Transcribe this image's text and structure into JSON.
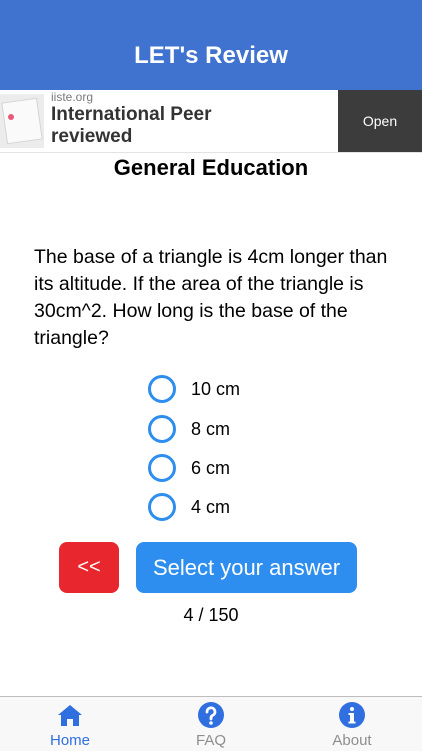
{
  "header": {
    "title": "LET's Review"
  },
  "ad": {
    "domain": "iiste.org",
    "headline": "International Peer reviewed",
    "cta": "Open"
  },
  "quiz": {
    "category": "General Education",
    "question": "The base of a triangle is 4cm longer than its altitude. If the area of the triangle is 30cm^2. How long is the base of the triangle?",
    "options": [
      "10 cm",
      "8 cm",
      "6 cm",
      "4 cm"
    ],
    "prev_label": "<<",
    "submit_label": "Select your answer",
    "progress": "4 / 150"
  },
  "tabs": [
    {
      "label": "Home",
      "icon": "home-icon"
    },
    {
      "label": "FAQ",
      "icon": "question-circle-icon"
    },
    {
      "label": "About",
      "icon": "info-circle-icon"
    }
  ],
  "colors": {
    "header": "#3f73cf",
    "accent": "#2d8ef0",
    "danger": "#e8262d",
    "active_tab": "#2f6fe0",
    "inactive_tab": "#8e8e8e"
  }
}
